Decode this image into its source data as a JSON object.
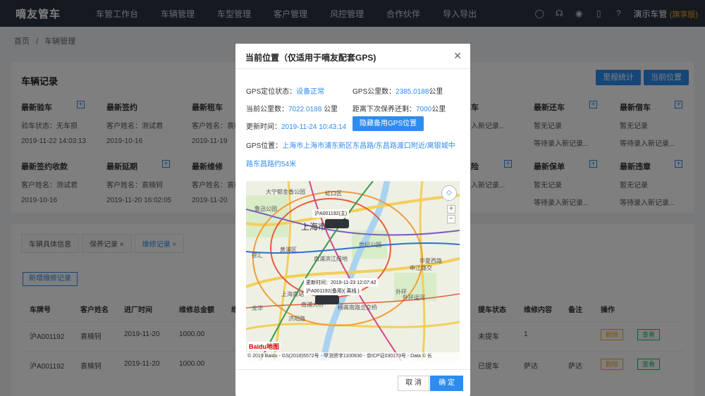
{
  "nav": {
    "brand": "嘀友管车",
    "menu": [
      "车管工作台",
      "车辆管理",
      "车型管理",
      "客户管理",
      "风控管理",
      "合作伙伴",
      "导入导出"
    ],
    "user_name": "演示车管",
    "user_tag": "(旗享版)"
  },
  "breadcrumb": [
    "首页",
    "/",
    "车辆管理"
  ],
  "records": {
    "title": "车辆记录",
    "btn_mileage": "里程统计",
    "btn_location": "当前位置",
    "row1": [
      {
        "title": "最新验车",
        "l1": "验车状态：无车损",
        "l2": "2019-11-22 14:03:13"
      },
      {
        "title": "最新签约",
        "l1": "客户姓名：测试君",
        "l2": "2019-10-16"
      },
      {
        "title": "最新租车",
        "l1": "客户姓名：袁楠",
        "l2": "2019-11-19"
      },
      {
        "title": "",
        "l1": "",
        "l2": ""
      },
      {
        "title": "",
        "l1": "",
        "l2": ""
      },
      {
        "title": "车",
        "l1": "",
        "l2": "入新记录..."
      },
      {
        "title": "最新还车",
        "l1": "暂无记录",
        "l2": "等待录入新记录..."
      },
      {
        "title": "最新借车",
        "l1": "暂无记录",
        "l2": "等待录入新记录..."
      }
    ],
    "row2": [
      {
        "title": "最新签约收款",
        "l1": "客户姓名：测试君",
        "l2": "2019-10-16"
      },
      {
        "title": "最新延期",
        "l1": "客户姓名：袁楠钶",
        "l2": "2019-11-20 16:02:05"
      },
      {
        "title": "最新维修",
        "l1": "客户姓名：袁楠",
        "l2": "2019-11-20"
      },
      {
        "title": "",
        "l1": "",
        "l2": ""
      },
      {
        "title": "",
        "l1": "",
        "l2": ""
      },
      {
        "title": "险",
        "l1": "",
        "l2": "入新记录..."
      },
      {
        "title": "最新保单",
        "l1": "暂无记录",
        "l2": "等待录入新记录..."
      },
      {
        "title": "最新违章",
        "l1": "暂无记录",
        "l2": "等待录入新记录..."
      }
    ]
  },
  "tabs": {
    "items": [
      "车辆具体信息",
      "保养记录 ×",
      "维修记录 ×"
    ],
    "add_btn": "新增维修记录",
    "headers": [
      "车牌号",
      "客户姓名",
      "进厂时间",
      "维修总金额",
      "维",
      "提车状态",
      "维修内容",
      "备注",
      "操作"
    ],
    "rows": [
      {
        "plate": "沪A001192",
        "name": "袁楠钶",
        "date": "2019-11-20",
        "amount": "1000.00",
        "status": "未提车",
        "content": "1",
        "note": "",
        "del": "删除",
        "view": "查看"
      },
      {
        "plate": "沪A001192",
        "name": "袁楠钶",
        "date": "2019-11-20",
        "amount": "1000.00",
        "status": "已提车",
        "content": "萨达",
        "note": "萨达",
        "del": "删除",
        "view": "查看"
      }
    ]
  },
  "modal": {
    "title": "当前位置（仅适用于嘀友配套GPS)",
    "gps_status_label": "GPS定位状态：",
    "gps_status": "设备正常",
    "gps_mileage_label": "GPS公里数：",
    "gps_mileage": "2385.0188",
    "km": "公里",
    "cur_mileage_label": "当前公里数：",
    "cur_mileage": "7022.0188",
    "next_service_label": "距离下次保养还剩：",
    "next_service": "7000",
    "update_label": "更新时间：",
    "update_time": "2019-11-24 10:43:14",
    "hide_btn": "隐藏备用GPS位置",
    "addr_label": "GPS位置：",
    "addr": "上海市上海市浦东新区东昌路/东昌路渡口附近/离银城中路东昌路约54米",
    "map": {
      "city": "上海市",
      "car1": "沪A001192(主)",
      "car2_time": "更新时间：2019-11-23 12:07:42",
      "car2": "沪A001192(备用)( 离线 )",
      "labels": [
        "大宁郁金香公园",
        "虹口区",
        "鲁迅公园",
        "黄浦区",
        "世纪公园",
        "南浦滨江绿地",
        "华夏西路",
        "申江路交",
        "外环",
        "上海南站",
        "杨高南路立交桥",
        "徐汇",
        "龙华",
        "南浦大桥",
        "济阳路",
        "外环运河"
      ],
      "footer": "© 2019 Baidu - GS(2018)5572号 - 甲测资字1100930 - 京ICP证030173号 - Data © 长",
      "logo": "Baidu地图"
    },
    "cancel": "取 消",
    "ok": "确 定"
  }
}
